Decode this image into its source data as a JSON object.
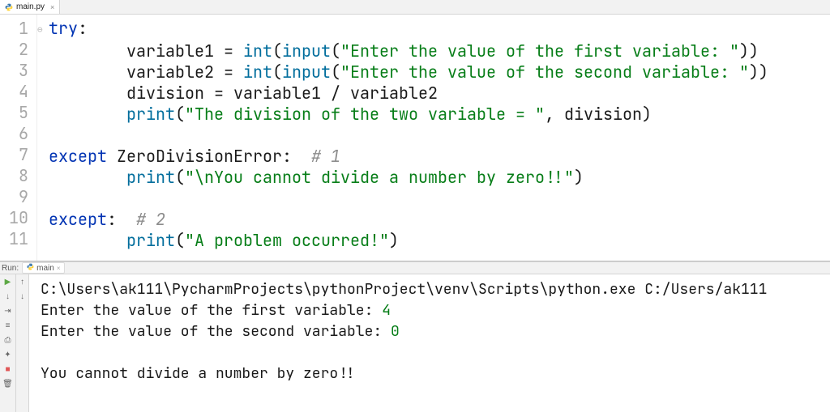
{
  "tabs": {
    "active": {
      "icon": "python-file-icon",
      "label": "main.py"
    }
  },
  "gutter": [
    "1",
    "2",
    "3",
    "4",
    "5",
    "6",
    "7",
    "8",
    "9",
    "10",
    "11"
  ],
  "code": {
    "l1_kw": "try",
    "colon": ":",
    "l2_a": "        variable1 = ",
    "l2_int": "int",
    "l2_p1": "(",
    "l2_input": "input",
    "l2_p2": "(",
    "l2_str": "\"Enter the value of the first variable: \"",
    "l2_close": "))",
    "l3_a": "        variable2 = ",
    "l3_int": "int",
    "l3_p1": "(",
    "l3_input": "input",
    "l3_p2": "(",
    "l3_str": "\"Enter the value of the second variable: \"",
    "l3_close": "))",
    "l4": "        division = variable1 / variable2",
    "l5_pad": "        ",
    "l5_print": "print",
    "l5_p1": "(",
    "l5_str": "\"The division of the two variable = \"",
    "l5_rest": ", division)",
    "l7_except": "except",
    "l7_sp": " ",
    "l7_err": "ZeroDivisionError",
    "l7_colon_sp": ":  ",
    "l7_cmt": "# 1",
    "l8_pad": "        ",
    "l8_print": "print",
    "l8_p1": "(",
    "l8_str": "\"\\nYou cannot divide a number by zero!!\"",
    "l8_close": ")",
    "l10_except": "except",
    "l10_colon_sp": ":  ",
    "l10_cmt": "# 2",
    "l11_pad": "        ",
    "l11_print": "print",
    "l11_p1": "(",
    "l11_str": "\"A problem occurred!\"",
    "l11_close": ")"
  },
  "run": {
    "label": "Run:",
    "config": "main"
  },
  "console": {
    "cmd": "C:\\Users\\ak111\\PycharmProjects\\pythonProject\\venv\\Scripts\\python.exe C:/Users/ak111",
    "prompt1": "Enter the value of the first variable: ",
    "input1": "4",
    "prompt2": "Enter the value of the second variable: ",
    "input2": "0",
    "blank": "",
    "out": "You cannot divide a number by zero!!"
  },
  "toolbar_icons": {
    "run": "▶",
    "down": "↓",
    "up": "↑",
    "align": "⇥",
    "wrap": "≡",
    "print": "⎙",
    "pin": "✦",
    "stop": "■",
    "trash": "🗑"
  }
}
